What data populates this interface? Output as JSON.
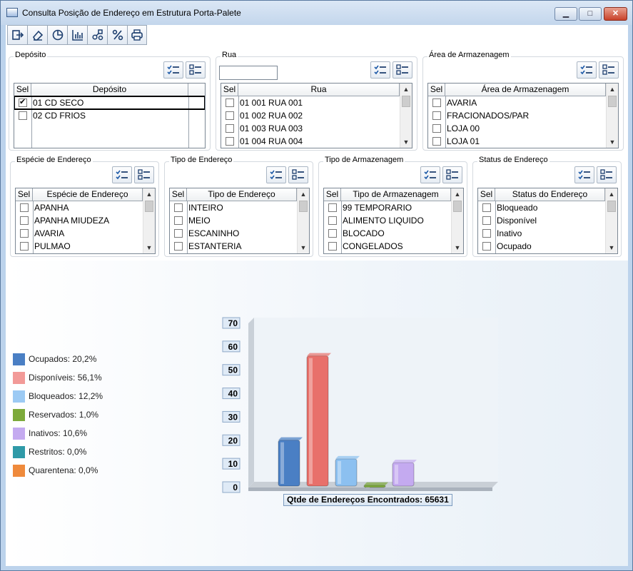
{
  "window": {
    "title": "Consulta Posição de Endereço em Estrutura Porta-Palete",
    "min_glyph": "▁",
    "max_glyph": "□",
    "close_glyph": "✕"
  },
  "toolbar": {
    "buttons": [
      "exit-icon",
      "eraser-icon",
      "pie-chart-icon",
      "bar-chart-icon",
      "flowchart-icon",
      "percent-icon",
      "print-icon"
    ]
  },
  "groups": {
    "deposito": {
      "title": "Depósito",
      "sel_header": "Sel",
      "col_header": "Depósito",
      "rows": [
        {
          "label": "01 CD SECO",
          "checked": true
        },
        {
          "label": "02 CD FRIOS",
          "checked": false
        }
      ]
    },
    "rua": {
      "title": "Rua",
      "filter_value": "",
      "sel_header": "Sel",
      "col_header": "Rua",
      "rows": [
        {
          "label": "01 001 RUA 001"
        },
        {
          "label": "01 002 RUA 002"
        },
        {
          "label": "01 003 RUA 003"
        },
        {
          "label": "01 004 RUA 004"
        }
      ]
    },
    "area": {
      "title": "Área de Armazenagem",
      "sel_header": "Sel",
      "col_header": "Área de Armazenagem",
      "rows": [
        {
          "label": "AVARIA"
        },
        {
          "label": "FRACIONADOS/PAR"
        },
        {
          "label": "LOJA 00"
        },
        {
          "label": "LOJA 01"
        }
      ]
    },
    "especie": {
      "title": "Espécie de Endereço",
      "sel_header": "Sel",
      "col_header": "Espécie de Endereço",
      "rows": [
        {
          "label": "APANHA"
        },
        {
          "label": "APANHA MIUDEZA"
        },
        {
          "label": "AVARIA"
        },
        {
          "label": "PULMAO"
        }
      ]
    },
    "tipo": {
      "title": "Tipo de Endereço",
      "sel_header": "Sel",
      "col_header": "Tipo de Endereço",
      "rows": [
        {
          "label": "INTEIRO"
        },
        {
          "label": "MEIO"
        },
        {
          "label": "ESCANINHO"
        },
        {
          "label": "ESTANTERIA"
        }
      ]
    },
    "tipo_armazenagem": {
      "title": "Tipo de Armazenagem",
      "sel_header": "Sel",
      "col_header": "Tipo de Armazenagem",
      "rows": [
        {
          "label": "99 TEMPORARIO"
        },
        {
          "label": "ALIMENTO LIQUIDO"
        },
        {
          "label": "BLOCADO"
        },
        {
          "label": "CONGELADOS"
        }
      ]
    },
    "status": {
      "title": "Status de Endereço",
      "sel_header": "Sel",
      "col_header": "Status do Endereço",
      "rows": [
        {
          "label": "Bloqueado"
        },
        {
          "label": "Disponível"
        },
        {
          "label": "Inativo"
        },
        {
          "label": "Ocupado"
        }
      ]
    }
  },
  "legend": [
    {
      "label": "Ocupados:  20,2%",
      "color": "#4a7fc4"
    },
    {
      "label": "Disponíveis: 56,1%",
      "color": "#f29a98"
    },
    {
      "label": "Bloqueados: 12,2%",
      "color": "#9ccaf4"
    },
    {
      "label": "Reservados: 1,0%",
      "color": "#7daa3b"
    },
    {
      "label": "Inativos: 10,6%",
      "color": "#c4aaf0"
    },
    {
      "label": "Restritos:  0,0%",
      "color": "#2f9aa8"
    },
    {
      "label": "Quarentena:  0,0%",
      "color": "#ef8a3c"
    }
  ],
  "chart_data": {
    "type": "bar",
    "categories": [
      "Ocupados",
      "Disponíveis",
      "Bloqueados",
      "Reservados",
      "Inativos",
      "Restritos",
      "Quarentena"
    ],
    "values": [
      20.2,
      56.1,
      12.2,
      1.0,
      10.6,
      0.0,
      0.0
    ],
    "colors": [
      "#4a7fc4",
      "#e8706b",
      "#8cc0f0",
      "#7daa3b",
      "#c4aaf0",
      "#2f9aa8",
      "#ef8a3c"
    ],
    "ylim": [
      0,
      70
    ],
    "yticks": [
      "0",
      "10",
      "20",
      "30",
      "40",
      "50",
      "60",
      "70"
    ],
    "xlabel": "Qtde de Endereços Encontrados: 65631"
  }
}
